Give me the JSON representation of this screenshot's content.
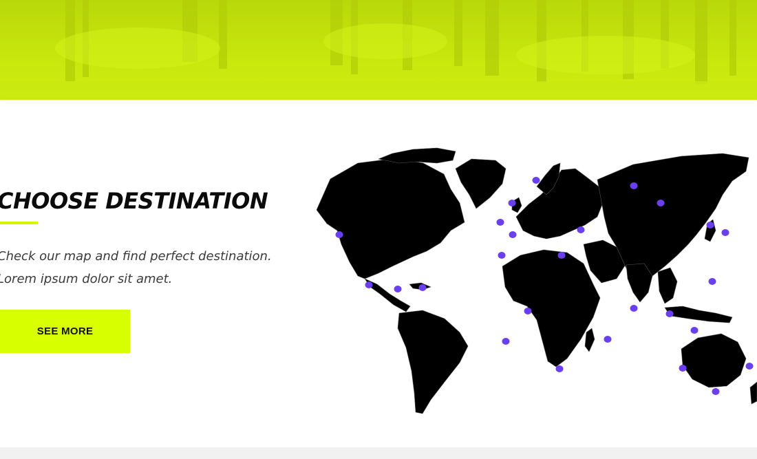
{
  "hero": {
    "image": "forest-banner",
    "tint_color": "#c6e60a"
  },
  "section": {
    "title": "CHOOSE DESTINATION",
    "description_lines": [
      "Check our map and find perfect destination.",
      "Lorem ipsum dolor sit amet."
    ],
    "cta_label": "SEE MORE",
    "accent_color": "#d7ff00"
  },
  "map": {
    "image": "world-map",
    "land_color": "#000000",
    "marker_color": "#6a3ff0",
    "marker_count": 26
  }
}
